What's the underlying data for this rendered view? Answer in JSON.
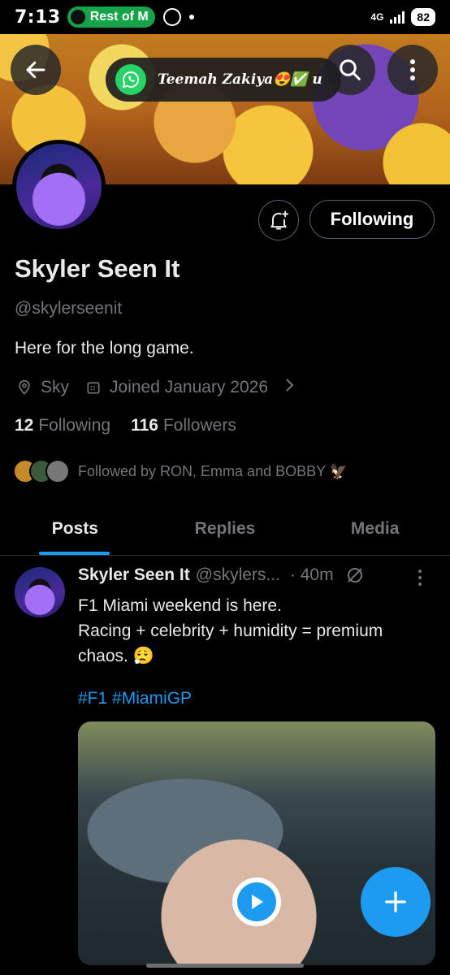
{
  "status_bar": {
    "time": "7:13",
    "media_label": "Rest of M",
    "network": "4G",
    "battery": "82"
  },
  "notification": {
    "app_icon": "whatsapp-icon",
    "text": "Teemah Zakiya😍✅ u"
  },
  "profile": {
    "name": "Skyler Seen It",
    "handle": "@skylerseenit",
    "bio": "Here for the long game.",
    "location": "Sky",
    "joined": "Joined January 2026",
    "following_count": "12",
    "following_label": "Following",
    "followers_count": "116",
    "followers_label": "Followers",
    "followed_by": "Followed by RON, Emma and BOBBY 🦅",
    "follow_button": "Following"
  },
  "tabs": [
    {
      "label": "Posts",
      "active": true
    },
    {
      "label": "Replies",
      "active": false
    },
    {
      "label": "Media",
      "active": false
    }
  ],
  "post": {
    "author": "Skyler Seen It",
    "handle": "@skylers...",
    "time": "· 40m",
    "text_line1": "F1 Miami weekend is here.",
    "text_line2": "Racing + celebrity + humidity = premium chaos. 😮‍💨",
    "hashtags": "#F1 #MiamiGP"
  },
  "colors": {
    "accent": "#1d9bf0",
    "background": "#000000",
    "secondary_text": "#71767b"
  }
}
